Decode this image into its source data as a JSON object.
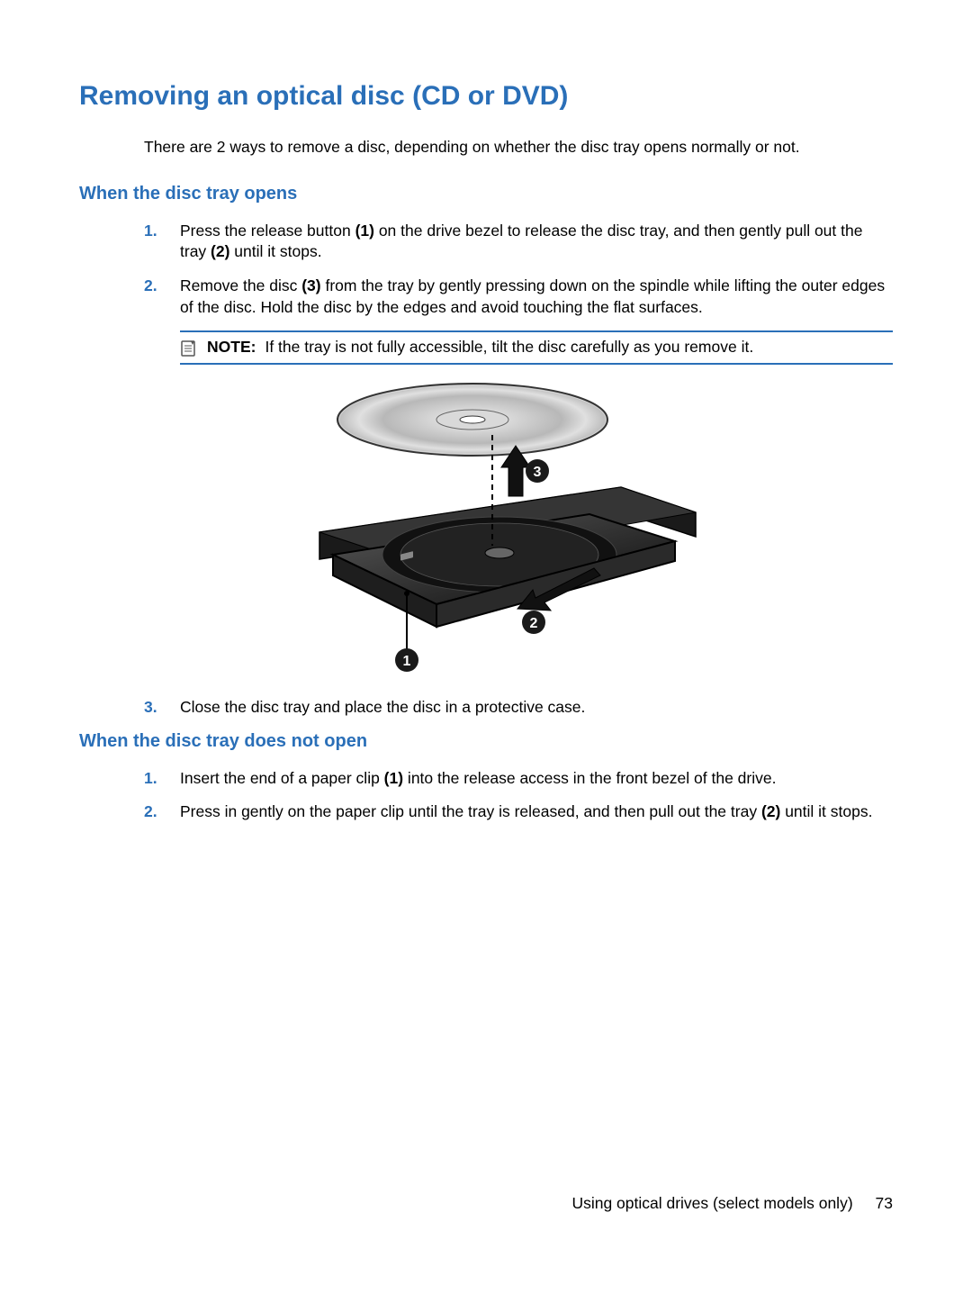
{
  "heading": "Removing an optical disc (CD or DVD)",
  "intro": "There are 2 ways to remove a disc, depending on whether the disc tray opens normally or not.",
  "section1": {
    "title": "When the disc tray opens",
    "step1": {
      "num": "1.",
      "before": "Press the release button ",
      "b1": "(1)",
      "mid": " on the drive bezel to release the disc tray, and then gently pull out the tray ",
      "b2": "(2)",
      "after": " until it stops."
    },
    "step2": {
      "num": "2.",
      "before": "Remove the disc ",
      "b1": "(3)",
      "after": " from the tray by gently pressing down on the spindle while lifting the outer edges of the disc. Hold the disc by the edges and avoid touching the flat surfaces."
    },
    "note": {
      "label": "NOTE:",
      "text": "If the tray is not fully accessible, tilt the disc carefully as you remove it."
    },
    "callouts": {
      "c1": "1",
      "c2": "2",
      "c3": "3"
    },
    "step3": {
      "num": "3.",
      "text": "Close the disc tray and place the disc in a protective case."
    }
  },
  "section2": {
    "title": "When the disc tray does not open",
    "step1": {
      "num": "1.",
      "before": "Insert the end of a paper clip ",
      "b1": "(1)",
      "after": " into the release access in the front bezel of the drive."
    },
    "step2": {
      "num": "2.",
      "before": "Press in gently on the paper clip until the tray is released, and then pull out the tray ",
      "b1": "(2)",
      "after": " until it stops."
    }
  },
  "footer": {
    "section": "Using optical drives (select models only)",
    "page": "73"
  }
}
